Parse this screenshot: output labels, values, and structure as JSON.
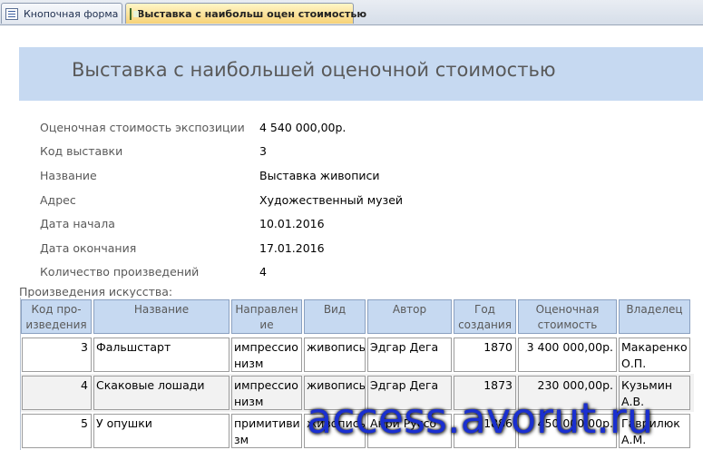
{
  "tabs": [
    {
      "label": "Кнопочная форма",
      "icon": "form-icon"
    },
    {
      "label": "Выставка с наибольш оцен стоимостью",
      "icon": "report-icon"
    }
  ],
  "report": {
    "title": "Выставка с наибольшей оценочной стоимостью",
    "fields": [
      {
        "label": "Оценочная стоимость экспозиции",
        "value": "4 540 000,00р."
      },
      {
        "label": "Код выставки",
        "value": "3"
      },
      {
        "label": "Название",
        "value": "Выставка живописи"
      },
      {
        "label": "Адрес",
        "value": "Художественный музей"
      },
      {
        "label": "Дата начала",
        "value": "10.01.2016"
      },
      {
        "label": "Дата окончания",
        "value": "17.01.2016"
      },
      {
        "label": "Количество произведений",
        "value": "4"
      }
    ],
    "subform_label": "Произведения искусства:"
  },
  "table": {
    "headers": [
      {
        "line1": "Код про-",
        "line2": "изведения"
      },
      {
        "line1": "Название",
        "line2": ""
      },
      {
        "line1": "Направлен",
        "line2": "ие"
      },
      {
        "line1": "Вид",
        "line2": ""
      },
      {
        "line1": "Автор",
        "line2": ""
      },
      {
        "line1": "Год",
        "line2": "создания"
      },
      {
        "line1": "Оценочная",
        "line2": "стоимость"
      },
      {
        "line1": "Владелец",
        "line2": ""
      }
    ],
    "rows": [
      {
        "code": "3",
        "name": "Фальшстарт",
        "direction1": "импрессио",
        "direction2": "низм",
        "kind": "живопись",
        "author": "Эдгар Дега",
        "year": "1870",
        "cost": "3 400 000,00р.",
        "owner1": "Макаренко",
        "owner2": "О.П."
      },
      {
        "code": "4",
        "name": "Скаковые лошади",
        "direction1": "импрессио",
        "direction2": "низм",
        "kind": "живопись",
        "author": "Эдгар Дега",
        "year": "1873",
        "cost": "230 000,00р.",
        "owner1": "Кузьмин",
        "owner2": "А.В."
      },
      {
        "code": "5",
        "name": "У опушки",
        "direction1": "примитиви",
        "direction2": "зм",
        "kind": "живопись",
        "author": "Анри Руссо",
        "year": "1886",
        "cost": "450 000,00р.",
        "owner1": "Гаврилюк",
        "owner2": "А.М."
      }
    ]
  },
  "watermark": "access.avorut.ru"
}
